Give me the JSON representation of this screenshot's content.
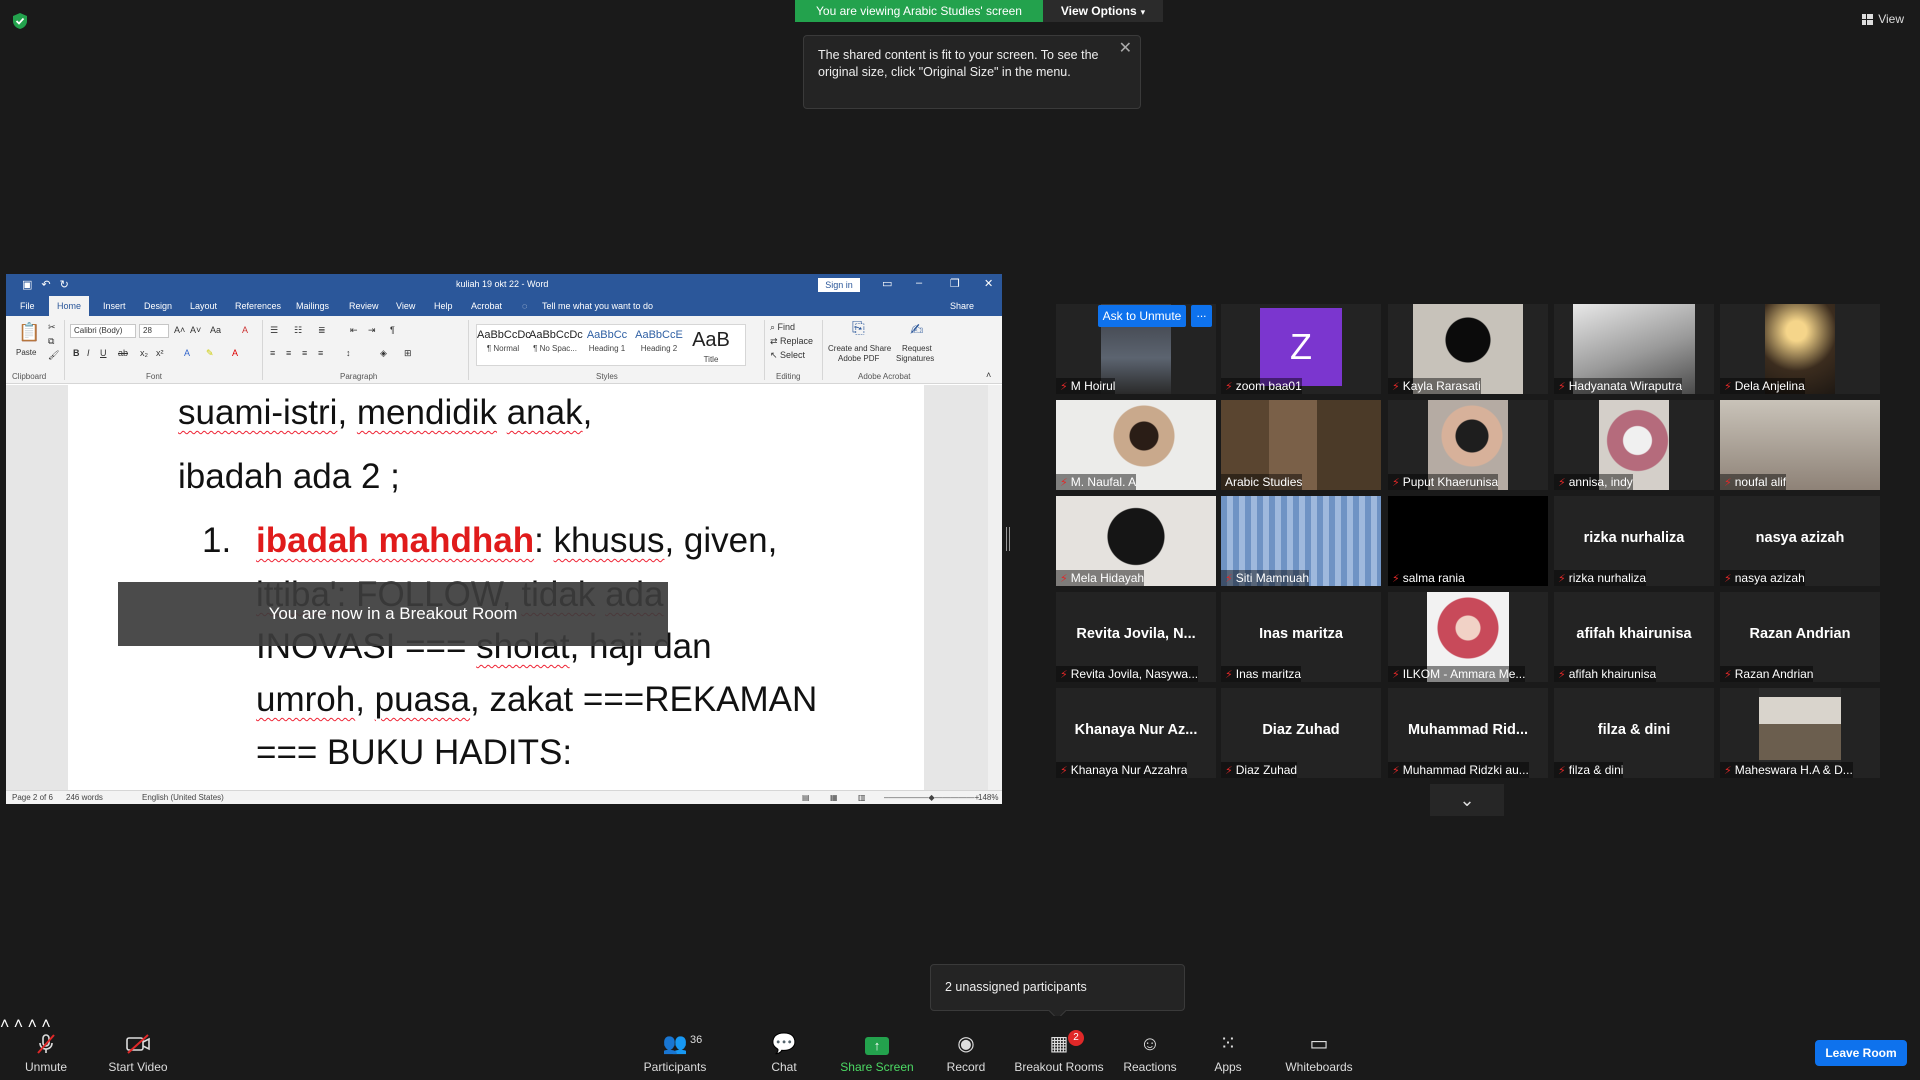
{
  "banner": {
    "viewing": "You are viewing Arabic Studies' screen",
    "view_options": "View Options",
    "view": "View"
  },
  "tooltip": {
    "text_1": "The shared content is fit to your screen. To see the",
    "text_2": "original size, click \"Original Size\" in the menu."
  },
  "word": {
    "title": "kuliah 19 okt 22  -  Word",
    "sign_in": "Sign in",
    "share": "Share",
    "tabs": [
      "File",
      "Home",
      "Insert",
      "Design",
      "Layout",
      "References",
      "Mailings",
      "Review",
      "View",
      "Help",
      "Acrobat"
    ],
    "tell_me": "Tell me what you want to do",
    "ribbon": {
      "paste": "Paste",
      "clipboard": "Clipboard",
      "font_name": "Calibri (Body)",
      "font_size": "28",
      "font": "Font",
      "paragraph": "Paragraph",
      "styles": "Styles",
      "editing": "Editing",
      "adobe": "Adobe Acrobat",
      "style_items": [
        {
          "preview": "AaBbCcDc",
          "label": "¶ Normal"
        },
        {
          "preview": "AaBbCcDc",
          "label": "¶ No Spac..."
        },
        {
          "preview": "AaBbCc",
          "label": "Heading 1"
        },
        {
          "preview": "AaBbCcE",
          "label": "Heading 2"
        },
        {
          "preview": "AaB",
          "label": "Title"
        }
      ],
      "find": "Find",
      "replace": "Replace",
      "select": "Select",
      "create_pdf_1": "Create and Share",
      "create_pdf_2": "Adobe PDF",
      "request_sig_1": "Request",
      "request_sig_2": "Signatures"
    },
    "doc": {
      "l1_a": "suami-istri",
      "l1_b": ", ",
      "l1_c": "mendidik",
      "l1_d": " ",
      "l1_e": "anak",
      "l1_f": ",",
      "l2": "ibadah ada 2 ;",
      "l3_num": "1.",
      "l3_red": "ibadah mahdhah",
      "l3_rest_a": ": ",
      "l3_rest_b": "khusus",
      "l3_rest_c": ", given,",
      "l4_a": "ittiba'",
      "l4_b": ": FOLLOW, ",
      "l4_c": "tidak",
      "l4_d": " ",
      "l4_e": "ada",
      "l5_a": "INOVASI === ",
      "l5_b": "sholat",
      "l5_c": ", haji dan",
      "l6_a": "umroh",
      "l6_b": ", ",
      "l6_c": "puasa",
      "l6_d": ", zakat ===REKAMAN",
      "l7": "=== BUKU HADITS:"
    },
    "status": {
      "page": "Page 2 of 6",
      "words": "246 words",
      "lang": "English (United States)",
      "zoom": "148%"
    }
  },
  "breakout_toast": "You are now in a Breakout Room",
  "gallery": {
    "ask_unmute": "Ask to Unmute",
    "more": "...",
    "tiles": [
      {
        "name": "M Hoirul",
        "center": ""
      },
      {
        "name": "zoom baa01",
        "center": ""
      },
      {
        "name": "Kayla Rarasati",
        "center": ""
      },
      {
        "name": "Hadyanata Wiraputra",
        "center": ""
      },
      {
        "name": "Dela Anjelina",
        "center": ""
      },
      {
        "name": "M. Naufal. A",
        "center": ""
      },
      {
        "name": "Arabic Studies",
        "center": ""
      },
      {
        "name": "Puput Khaerunisa",
        "center": ""
      },
      {
        "name": "annisa, indy",
        "center": ""
      },
      {
        "name": "noufal alif",
        "center": ""
      },
      {
        "name": "Mela Hidayah",
        "center": ""
      },
      {
        "name": "Siti Mamnuah",
        "center": ""
      },
      {
        "name": "salma rania",
        "center": ""
      },
      {
        "name": "rizka nurhaliza",
        "center": "rizka nurhaliza"
      },
      {
        "name": "nasya azizah",
        "center": "nasya azizah"
      },
      {
        "name": "Revita Jovila, Nasywa...",
        "center": "Revita Jovila, N..."
      },
      {
        "name": "Inas maritza",
        "center": "Inas maritza"
      },
      {
        "name": "ILKOM - Ammara Me...",
        "center": ""
      },
      {
        "name": "afifah khairunisa",
        "center": "afifah khairunisa"
      },
      {
        "name": "Razan Andrian",
        "center": "Razan Andrian"
      },
      {
        "name": "Khanaya Nur Azzahra",
        "center": "Khanaya Nur Az..."
      },
      {
        "name": "Diaz Zuhad",
        "center": "Diaz Zuhad"
      },
      {
        "name": "Muhammad Ridzki au...",
        "center": "Muhammad  Rid..."
      },
      {
        "name": "filza & dini",
        "center": "filza & dini"
      },
      {
        "name": "Maheswara H.A & D...",
        "center": ""
      }
    ],
    "z_letter": "Z"
  },
  "unassigned": "2 unassigned participants",
  "toolbar": {
    "unmute": "Unmute",
    "start_video": "Start Video",
    "participants": "Participants",
    "participants_count": "36",
    "chat": "Chat",
    "share_screen": "Share Screen",
    "record": "Record",
    "breakout_rooms": "Breakout Rooms",
    "breakout_badge": "2",
    "reactions": "Reactions",
    "apps": "Apps",
    "whiteboards": "Whiteboards",
    "leave": "Leave Room"
  }
}
